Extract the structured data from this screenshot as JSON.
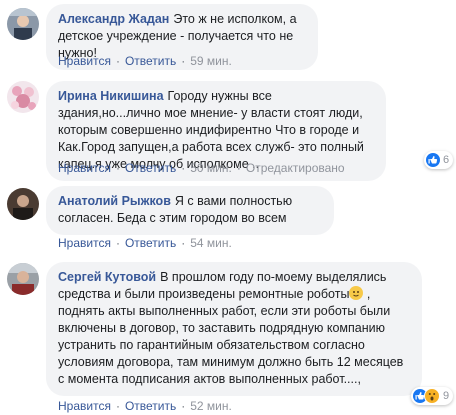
{
  "comments": [
    {
      "author": "Александр Жадан",
      "text": "Это ж не исполком, а детское учреждение - получается что не нужно!",
      "like_label": "Нравится",
      "reply_label": "Ответить",
      "time": "59 мин."
    },
    {
      "author": "Ирина Никишина",
      "text": "Городу нужны все здания,но...лично мое мнение- у власти стоят люди, которым совершенно индифирентно Что в городе и Как.Город запущен,а работа всех служб- это полный капец.я уже молчу об исполкоме ..",
      "like_label": "Нравится",
      "reply_label": "Ответить",
      "time": "50 мин.",
      "edited_label": "Отредактировано",
      "reaction_count": "6"
    },
    {
      "author": "Анатолий Рыжков",
      "text": "Я с вами полностью согласен. Беда с этим городом во всем",
      "like_label": "Нравится",
      "reply_label": "Ответить",
      "time": "54 мин."
    },
    {
      "author": "Сергей Кутовой",
      "text_before_emoji": "В прошлом году по-моему выделялись средства и были произведены ремонтные роботы",
      "text_after_emoji": " , поднять акты выполненных работ, если эти роботы были включены в договор, то заставить подрядную компанию устранить по гарантийным обязательством согласно условиям договора, там минимум должно быть 12 месяцев с момента подписания актов выполненных работ....,",
      "like_label": "Нравится",
      "reply_label": "Ответить",
      "time": "52 мин.",
      "reaction_count": "9"
    }
  ],
  "colors": {
    "author": "#385898",
    "bubble": "#f2f3f5",
    "like": "#1877f2",
    "wow": "#f7b125"
  }
}
